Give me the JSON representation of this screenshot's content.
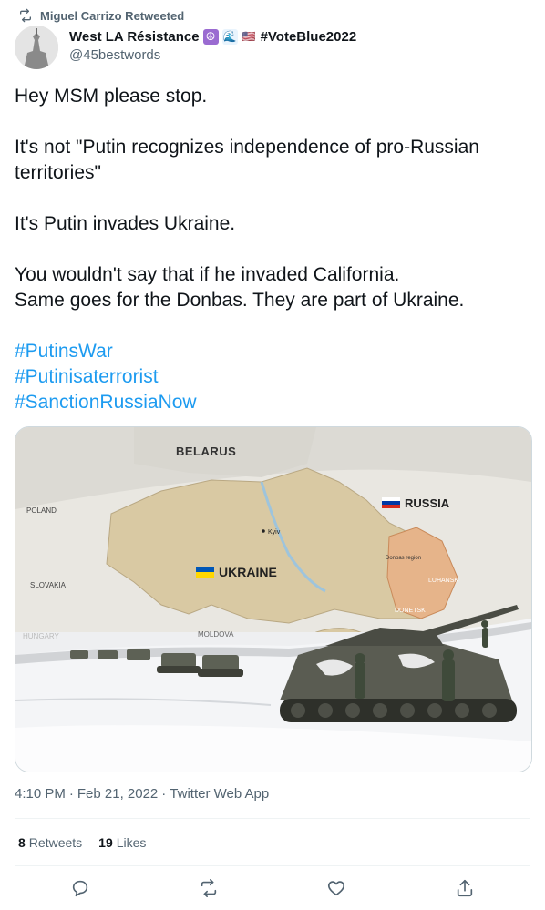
{
  "retweet_header": {
    "text": "Miguel Carrizo Retweeted",
    "icon": "retweet-icon"
  },
  "author": {
    "name": "West LA Résistance",
    "badges": [
      "☮",
      "🌊",
      "🇺🇸"
    ],
    "name_suffix": "#VoteBlue2022",
    "handle": "@45bestwords"
  },
  "tweet": {
    "lines": [
      "Hey MSM please stop.",
      "It's not \"Putin recognizes independence of pro-Russian territories\"",
      "It's Putin invades Ukraine.",
      "You wouldn't say that if he invaded California.",
      "Same goes for the Donbas. They are part of Ukraine."
    ],
    "hashtags": [
      "#PutinsWar",
      "#Putinisaterrorist",
      "#SanctionRussiaNow"
    ]
  },
  "media": {
    "map_labels": {
      "belarus": "BELARUS",
      "russia": "RUSSIA",
      "poland": "POLAND",
      "kyiv": "Kyiv",
      "ukraine": "UKRAINE",
      "slovakia": "SLOVAKIA",
      "donbas": "Donbas region",
      "luhansk": "LUHANSK",
      "donetsk": "DONETSK",
      "hungary": "HUNGARY",
      "moldova": "MOLDOVA"
    },
    "colors": {
      "ukraine_land": "#d9c9a3",
      "donbas": "#e6b48a",
      "snow": "#f4f5f7"
    }
  },
  "meta": {
    "time": "4:10 PM",
    "separator": "·",
    "date": "Feb 21, 2022",
    "app": "Twitter Web App"
  },
  "stats": {
    "retweets_count": "8",
    "retweets_label": "Retweets",
    "likes_count": "19",
    "likes_label": "Likes"
  },
  "actions": {
    "reply": "reply-icon",
    "retweet": "retweet-icon",
    "like": "heart-icon",
    "share": "share-icon"
  },
  "colors": {
    "link": "#1d9bf0",
    "secondary_text": "#536471",
    "primary_text": "#0f1419"
  }
}
